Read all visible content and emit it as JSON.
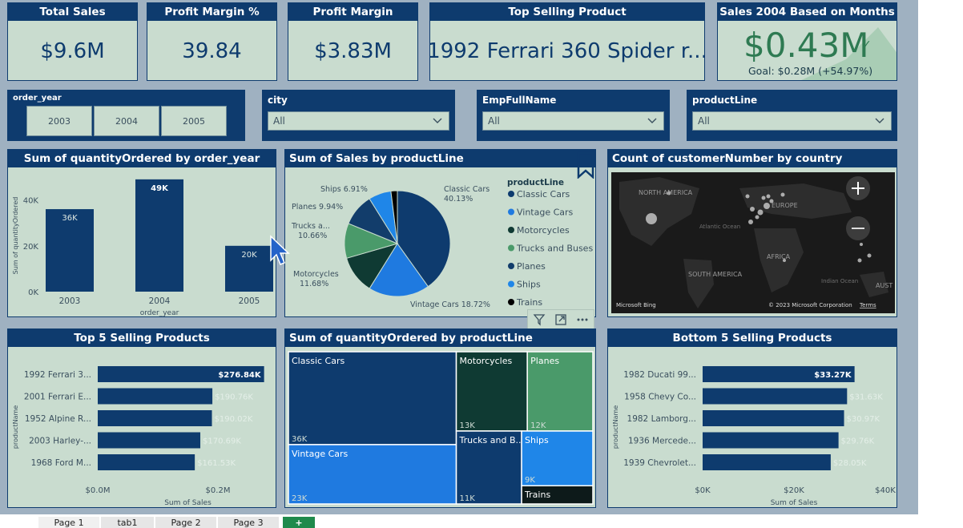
{
  "kpis": {
    "total_sales": {
      "title": "Total Sales",
      "value": "$9.6M"
    },
    "profit_margin_pct": {
      "title": "Profit Margin %",
      "value": "39.84"
    },
    "profit_margin": {
      "title": "Profit Margin",
      "value": "$3.83M"
    },
    "top_selling_product": {
      "title": "Top Selling Product",
      "value": "1992 Ferrari 360 Spider r..."
    },
    "sales_2004": {
      "title": "Sales 2004 Based on Months",
      "value": "$0.43M",
      "check": "✓",
      "goal": "Goal: $0.28M (+54.97%)"
    }
  },
  "slicers": {
    "order_year": {
      "label": "order_year",
      "options": [
        "2003",
        "2004",
        "2005"
      ]
    },
    "city": {
      "label": "city",
      "selected": "All"
    },
    "emp": {
      "label": "EmpFullName",
      "selected": "All"
    },
    "productline": {
      "label": "productLine",
      "selected": "All"
    }
  },
  "charts": {
    "qty_by_year": {
      "title": "Sum of quantityOrdered by order_year"
    },
    "sales_by_productline": {
      "title": "Sum of Sales by productLine",
      "legend_title": "productLine"
    },
    "customers_by_country": {
      "title": "Count of customerNumber by country",
      "map_labels": [
        "NORTH AMERICA",
        "EUROPE",
        "Atlantic Ocean",
        "AFRICA",
        "SOUTH AMERICA",
        "Indian Ocean",
        "AUST"
      ],
      "bing": "Microsoft Bing",
      "copyright": "© 2023 Microsoft Corporation",
      "terms": "Terms"
    },
    "top5": {
      "title": "Top 5 Selling Products"
    },
    "qty_by_productline": {
      "title": "Sum of quantityOrdered by productLine"
    },
    "bottom5": {
      "title": "Bottom 5 Selling Products"
    }
  },
  "visual_header_icons": [
    "filter-icon",
    "focus-mode-icon",
    "more-options-icon"
  ],
  "tabs": [
    "Page 1",
    "tab1",
    "Page 2",
    "Page 3"
  ],
  "add_tab": "+",
  "colors": {
    "navy": "#0e3b6e",
    "panel": "#c9dccf",
    "canvas": "#9fb1c1",
    "darkgreen": "#0f3a33",
    "blue": "#1f7ae0",
    "green": "#4a9a6a"
  },
  "chart_data": [
    {
      "type": "bar",
      "title": "Sum of quantityOrdered by order_year",
      "categories": [
        "2003",
        "2004",
        "2005"
      ],
      "values": [
        36000,
        49000,
        20000
      ],
      "data_labels": [
        "36K",
        "49K",
        "20K"
      ],
      "xlabel": "order_year",
      "ylabel": "Sum of quantityOrdered",
      "ylim": [
        0,
        50000
      ],
      "yticks": [
        "0K",
        "20K",
        "40K"
      ],
      "ytick_values": [
        0,
        20000,
        40000
      ]
    },
    {
      "type": "pie",
      "title": "Sum of Sales by productLine",
      "categories": [
        "Classic Cars",
        "Vintage Cars",
        "Motorcycles",
        "Trucks and Buses",
        "Planes",
        "Ships",
        "Trains"
      ],
      "values": [
        40.13,
        18.72,
        11.68,
        10.66,
        9.94,
        6.91,
        1.96
      ],
      "labels": [
        "Classic Cars 40.13%",
        "Vintage Cars 18.72%",
        "Motorcycles 11.68%",
        "Trucks a... 10.66%",
        "Planes 9.94%",
        "Ships 6.91%",
        ""
      ],
      "colors": [
        "#0e3b6e",
        "#1f7ae0",
        "#0f3a33",
        "#4a9a6a",
        "#123d6b",
        "#1f86e8",
        "#000000"
      ],
      "legend": "right"
    },
    {
      "type": "bar",
      "orientation": "horizontal",
      "title": "Top 5 Selling Products",
      "categories": [
        "1992 Ferrari 3...",
        "2001 Ferrari E...",
        "1952 Alpine R...",
        "2003 Harley-...",
        "1968 Ford M..."
      ],
      "values": [
        276840,
        190760,
        190020,
        170690,
        161530
      ],
      "data_labels": [
        "$276.84K",
        "$190.76K",
        "$190.02K",
        "$170.69K",
        "$161.53K"
      ],
      "xlabel": "Sum of Sales",
      "ylabel": "productName",
      "xlim": [
        0,
        300000
      ],
      "xticks": [
        "$0.0M",
        "$0.2M"
      ],
      "xtick_values": [
        0,
        200000
      ]
    },
    {
      "type": "treemap",
      "title": "Sum of quantityOrdered by productLine",
      "categories": [
        "Classic Cars",
        "Vintage Cars",
        "Motorcycles",
        "Trucks and B...",
        "Planes",
        "Ships",
        "Trains"
      ],
      "values": [
        36000,
        23000,
        13000,
        11000,
        12000,
        9000,
        3000
      ],
      "data_labels": [
        "36K",
        "23K",
        "13K",
        "11K",
        "12K",
        "9K",
        ""
      ]
    },
    {
      "type": "bar",
      "orientation": "horizontal",
      "title": "Bottom 5 Selling Products",
      "categories": [
        "1982 Ducati 99...",
        "1958 Chevy Co...",
        "1982 Lamborg...",
        "1936 Mercede...",
        "1939 Chevrolet..."
      ],
      "values": [
        33270,
        31630,
        30970,
        29760,
        28050
      ],
      "data_labels": [
        "$33.27K",
        "$31.63K",
        "$30.97K",
        "$29.76K",
        "$28.05K"
      ],
      "xlabel": "Sum of Sales",
      "ylabel": "productName",
      "xlim": [
        0,
        40000
      ],
      "xticks": [
        "$0K",
        "$20K",
        "$40K"
      ],
      "xtick_values": [
        0,
        20000,
        40000
      ]
    }
  ]
}
